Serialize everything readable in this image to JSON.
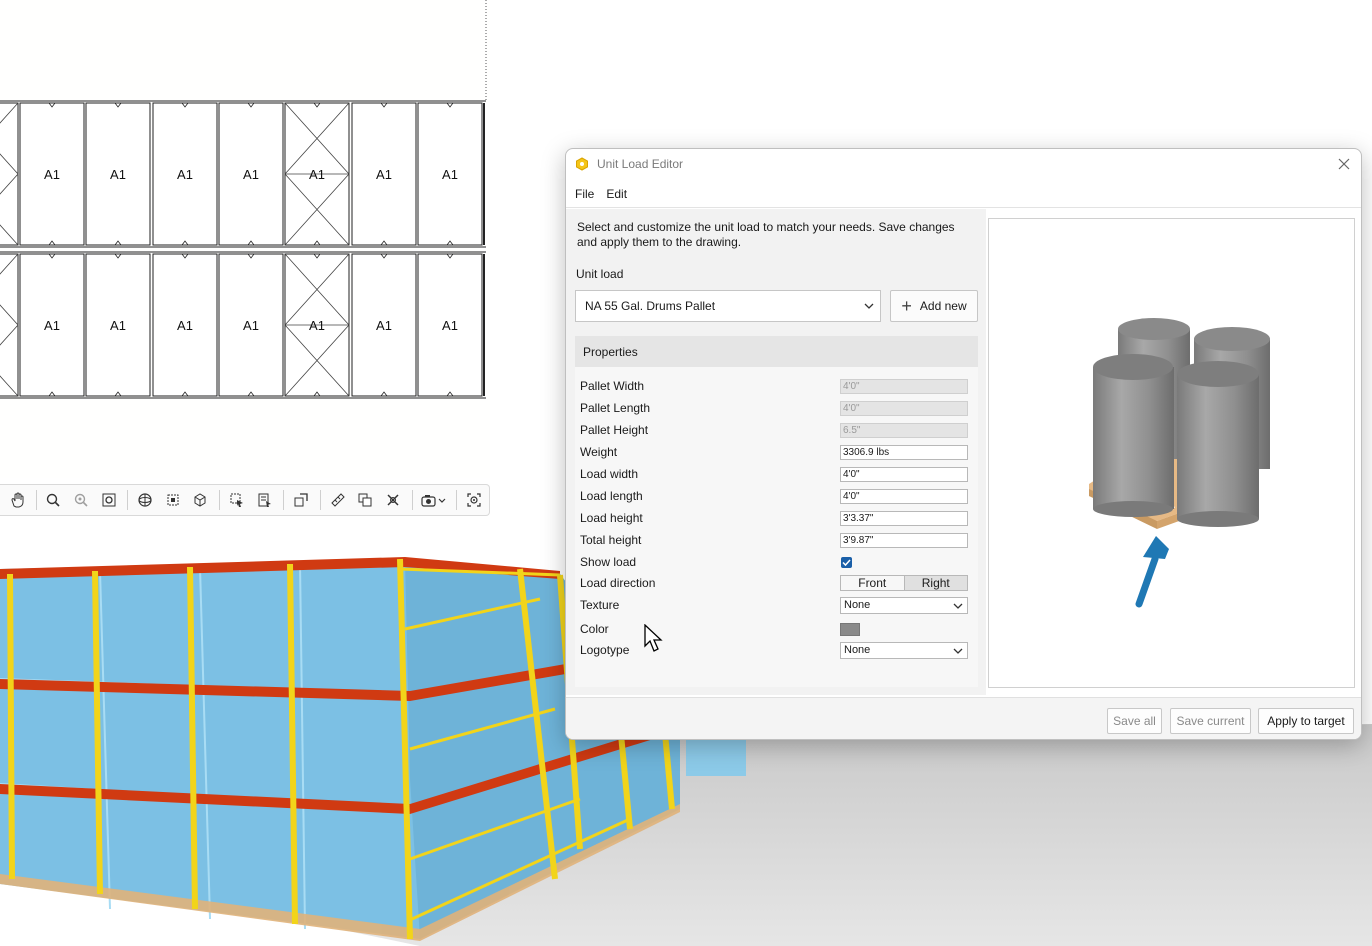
{
  "plan": {
    "cell_label": "A1"
  },
  "toolbar": {
    "icons": [
      "pan-icon",
      "zoom-icon",
      "zoom-window-icon",
      "zoom-extents-icon",
      "orbit-icon",
      "zoom-selection-icon",
      "view-cube-icon",
      "select-icon",
      "select-list-icon",
      "move-icon",
      "measure-icon",
      "copy-icon",
      "delete-icon",
      "camera-icon",
      "focus-icon"
    ]
  },
  "dialog": {
    "title": "Unit Load Editor",
    "menu": {
      "file": "File",
      "edit": "Edit"
    },
    "intro": "Select and customize the unit load to match your needs. Save changes and apply them to the drawing.",
    "unit_load_label": "Unit load",
    "unit_load_value": "NA 55 Gal. Drums Pallet",
    "add_new": "Add new",
    "properties_header": "Properties",
    "properties": {
      "pallet_width": {
        "label": "Pallet Width",
        "value": "4'0\""
      },
      "pallet_length": {
        "label": "Pallet Length",
        "value": "4'0\""
      },
      "pallet_height": {
        "label": "Pallet Height",
        "value": "6.5\""
      },
      "weight": {
        "label": "Weight",
        "value": "3306.9 lbs"
      },
      "load_width": {
        "label": "Load width",
        "value": "4'0\""
      },
      "load_length": {
        "label": "Load length",
        "value": "4'0\""
      },
      "load_height": {
        "label": "Load height",
        "value": "3'3.37\""
      },
      "total_height": {
        "label": "Total height",
        "value": "3'9.87\""
      },
      "show_load": {
        "label": "Show load",
        "checked": true
      },
      "load_direction": {
        "label": "Load direction",
        "options": [
          "Front",
          "Right"
        ],
        "selected": "Right"
      },
      "texture": {
        "label": "Texture",
        "value": "None"
      },
      "color": {
        "label": "Color",
        "value": "#8a8a8a"
      },
      "logotype": {
        "label": "Logotype",
        "value": "None"
      }
    },
    "footer": {
      "save_all": "Save all",
      "save_current": "Save current",
      "apply_to_target": "Apply to target"
    }
  },
  "colors": {
    "rack_upright": "#f2d41a",
    "rack_beam": "#d03a12",
    "load_box": "#8ccae8",
    "pallet": "#e0b27a",
    "drum": "#8f8f8f",
    "arrow": "#1f78b4",
    "checkbox": "#1a5fa8"
  }
}
